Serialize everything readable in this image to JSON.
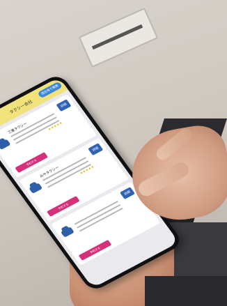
{
  "scene": {
    "subject": "hand holding smartphone showing taxi booking app"
  },
  "phone_app": {
    "appbar": {
      "back_label": "戻る",
      "title": "タクシー会社",
      "top_button_label": "現在地で検索"
    },
    "cards": [
      {
        "name": "三重タクシー",
        "detail_label": "詳細",
        "reserve_label": "予約する",
        "rating": "★★★★★"
      },
      {
        "name": "みやタクシー",
        "detail_label": "詳細",
        "reserve_label": "予約する",
        "rating": "★★★★★"
      },
      {
        "name": "",
        "detail_label": "詳細",
        "reserve_label": "予約する",
        "rating": ""
      }
    ]
  }
}
